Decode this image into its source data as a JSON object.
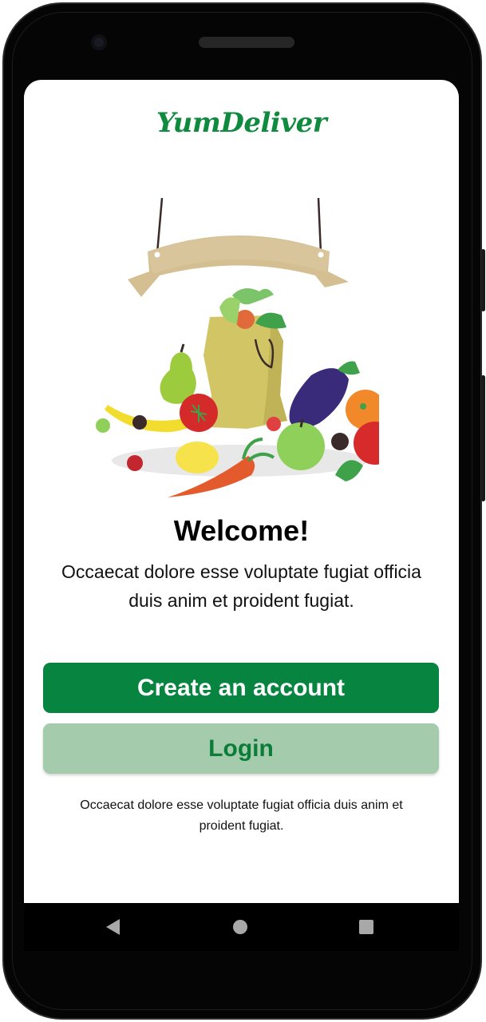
{
  "app": {
    "logo_text": "YumDeliver"
  },
  "welcome": {
    "title": "Welcome!",
    "subtitle": "Occaecat dolore esse voluptate fugiat officia duis anim et proident fugiat."
  },
  "actions": {
    "create_account_label": "Create an account",
    "login_label": "Login"
  },
  "footer": {
    "text": "Occaecat dolore esse voluptate fugiat officia duis anim et proident fugiat."
  },
  "colors": {
    "brand_green": "#07843f",
    "login_bg": "#a3cbac",
    "login_text": "#0b7d39"
  },
  "icons": {
    "hero": "grocery-bag-illustration",
    "nav_back": "back-triangle-icon",
    "nav_home": "home-circle-icon",
    "nav_recent": "recent-apps-square-icon"
  }
}
